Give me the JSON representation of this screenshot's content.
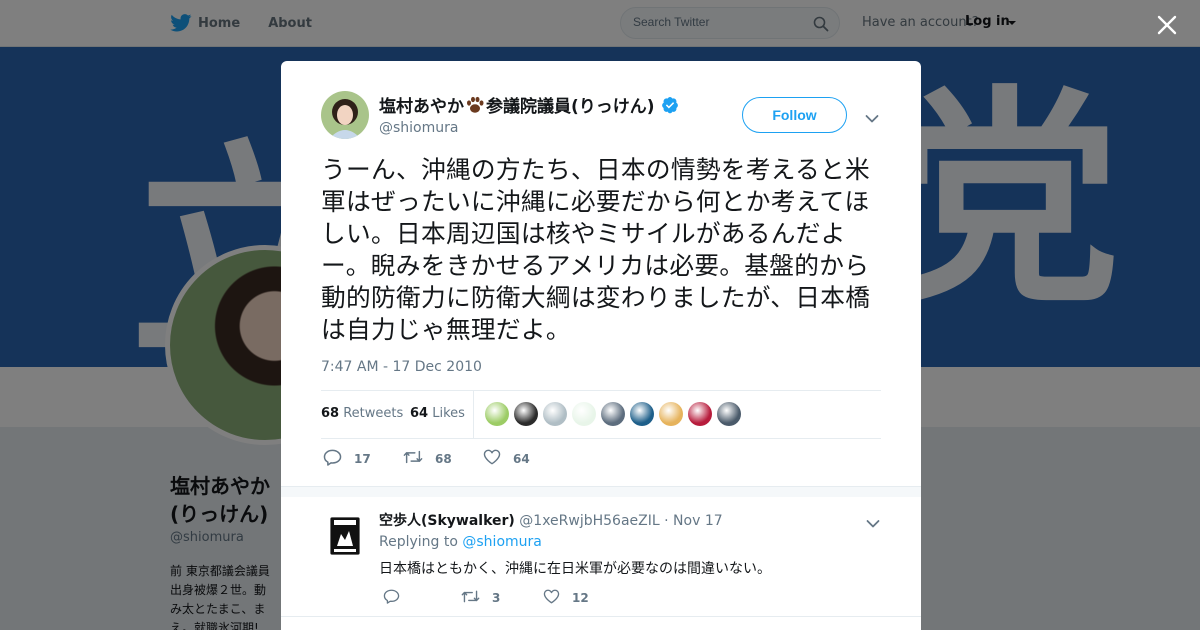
{
  "nav": {
    "home_label": "Home",
    "about_label": "About",
    "search_placeholder": "Search Twitter",
    "have_account_text": "Have an account?",
    "login_label": "Log in"
  },
  "background_profile": {
    "banner_text_left": "立",
    "banner_text_right": "党",
    "name": "塩村あやか\n(りっけん)",
    "handle": "@shiomura",
    "bio": "前 東京都議会議員\n出身被爆２世。動\nみ太とたまこ、ま\nえ。就職氷河期!"
  },
  "tweet": {
    "author_name_part1": "塩村あやか",
    "author_name_part2": "参議院議員(りっけん)",
    "author_handle": "@shiomura",
    "follow_label": "Follow",
    "text": "うーん、沖縄の方たち、日本の情勢を考えると米軍はぜったいに沖縄に必要だから何とか考えてほしい。日本周辺国は核やミサイルがあるんだよー。睨みをきかせるアメリカは必要。基盤的から動的防衛力に防衛大綱は変わりましたが、日本橋は自力じゃ無理だよ。",
    "timestamp": "7:47 AM - 17 Dec 2010",
    "retweets_count": "68",
    "retweets_label": "Retweets",
    "likes_count": "64",
    "likes_label": "Likes",
    "actions": {
      "reply_count": "17",
      "retweet_count": "68",
      "like_count": "64"
    }
  },
  "likers": [
    {
      "name": "liker-avatar-1",
      "color": "#9ccc65"
    },
    {
      "name": "liker-avatar-2",
      "color": "#2b2b2b"
    },
    {
      "name": "liker-avatar-3",
      "color": "#b0bec5"
    },
    {
      "name": "liker-avatar-4",
      "color": "#e8f5e9"
    },
    {
      "name": "liker-avatar-5",
      "color": "#5d6d7e"
    },
    {
      "name": "liker-avatar-6",
      "color": "#1e5f8a"
    },
    {
      "name": "liker-avatar-7",
      "color": "#e6b35c"
    },
    {
      "name": "liker-avatar-8",
      "color": "#b71c3c"
    },
    {
      "name": "liker-avatar-9",
      "color": "#4a5a6a"
    }
  ],
  "reply": {
    "name": "空歩人(Skywalker)",
    "handle": "@1xeRwjbH56aeZIL",
    "date": "· Nov 17",
    "replying_to_label": "Replying to",
    "replying_to_mention": "@shiomura",
    "text": "日本橋はともかく、沖縄に在日米軍が必要なのは間違いない。",
    "actions": {
      "reply_count": "",
      "retweet_count": "3",
      "like_count": "12"
    }
  },
  "colors": {
    "twitter_blue": "#1da1f2",
    "banner_blue": "#2a67b3",
    "muted_text": "#657786",
    "primary_text": "#14171a"
  }
}
